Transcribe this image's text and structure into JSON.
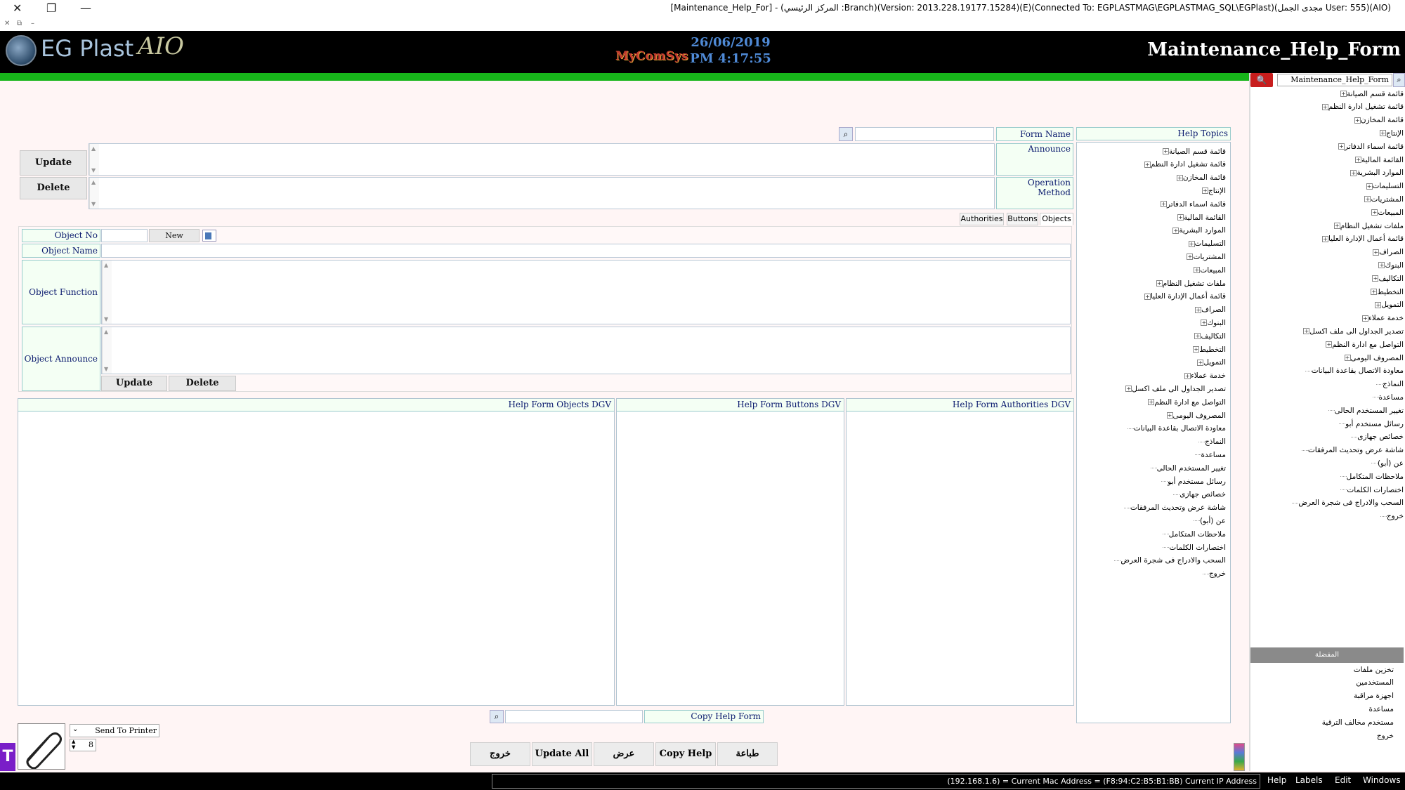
{
  "window": {
    "title": "[Maintenance_Help_For] - (المركز الرئيسي :Branch)(Version: 2013.228.19177.15284)(E)(Connected To: EGPLASTMAG\\EGPLASTMAG_SQL\\EGPlast)(مجدى الجمل User: 555)(AIO)",
    "close_glyph": "✕",
    "restore_glyph": "❐",
    "min_glyph": "—",
    "mini_close": "✕",
    "mini_restore": "⧉",
    "mini_min": "–"
  },
  "header": {
    "logo_text": "EG Plast",
    "logo_suffix": "AIO",
    "brand": "MyComSys",
    "date": "26/06/2019",
    "time": "PM 4:17:55",
    "form_title": "Maintenance_Help_Form"
  },
  "side_panel": {
    "search_value": "Maintenance_Help_Form",
    "search_button": "🔍",
    "items": [
      {
        "label": "قائمة قسم الصيانة",
        "expandable": true
      },
      {
        "label": "قائمة تشغيل ادارة النظم",
        "expandable": true
      },
      {
        "label": "قائمة المخازن",
        "expandable": true
      },
      {
        "label": "الإنتاج",
        "expandable": true
      },
      {
        "label": "قائمة اسماء الدفاتر",
        "expandable": true
      },
      {
        "label": "القائمة المالية",
        "expandable": true
      },
      {
        "label": "الموارد البشرية",
        "expandable": true
      },
      {
        "label": "التسليمات",
        "expandable": true
      },
      {
        "label": "المشتريات",
        "expandable": true
      },
      {
        "label": "المبيعات",
        "expandable": true
      },
      {
        "label": "ملفات تشغيل النظام",
        "expandable": true
      },
      {
        "label": "قائمة أعمال الإدارة العليا",
        "expandable": true
      },
      {
        "label": "الصراف",
        "expandable": true
      },
      {
        "label": "البنوك",
        "expandable": true
      },
      {
        "label": "التكاليف",
        "expandable": true
      },
      {
        "label": "التخطيط",
        "expandable": true
      },
      {
        "label": "التمويل",
        "expandable": true
      },
      {
        "label": "خدمة عملاء",
        "expandable": true
      },
      {
        "label": "تصدير الجداول الى ملف اكسل",
        "expandable": true
      },
      {
        "label": "التواصل مع ادارة النظم",
        "expandable": true
      },
      {
        "label": "المصروف اليومى",
        "expandable": true
      },
      {
        "label": "معاودة الاتصال بقاعدة البيانات",
        "expandable": false
      },
      {
        "label": "النماذج",
        "expandable": false
      },
      {
        "label": "مساعدة",
        "expandable": false
      },
      {
        "label": "تغيير المستخدم الحالى",
        "expandable": false
      },
      {
        "label": "رسائل مستخدم أبو",
        "expandable": false
      },
      {
        "label": "خصائص جهازى",
        "expandable": false
      },
      {
        "label": "شاشة عرض وتحديث المرفقات",
        "expandable": false
      },
      {
        "label": "عن (أبو)",
        "expandable": false
      },
      {
        "label": "ملاحظات المتكامل",
        "expandable": false
      },
      {
        "label": "اختصارات الكلمات",
        "expandable": false
      },
      {
        "label": "السحب والادراج فى شجرة العرض",
        "expandable": false
      },
      {
        "label": "خروج",
        "expandable": false
      }
    ],
    "favorites_title": "المفضلة",
    "favorites": [
      {
        "label": "تخزين ملفات"
      },
      {
        "label": "المستخدمين"
      },
      {
        "label": "اجهزة مراقبة"
      },
      {
        "label": "مساعدة"
      },
      {
        "label": "مستخدم مخالف الترقية"
      },
      {
        "label": "خروج"
      }
    ]
  },
  "form": {
    "help_topics_label": "Help Topics",
    "form_name_label": "Form Name",
    "form_name_value": "",
    "announce_label": "Announce",
    "operation_method_label": "Operation Method",
    "update_label": "Update",
    "delete_label": "Delete",
    "tabs": [
      {
        "label": "Authorities"
      },
      {
        "label": "Buttons"
      },
      {
        "label": "Objects"
      }
    ],
    "object_no_label": "Object No",
    "object_no_value": "",
    "new_label": "New",
    "object_name_label": "Object Name",
    "object_function_label": "Object Function",
    "object_announce_label": "Object Announce",
    "obj_update_label": "Update",
    "obj_delete_label": "Delete",
    "dgv_objects": "Help Form Objects DGV",
    "dgv_buttons": "Help Form Buttons DGV",
    "dgv_authorities": "Help Form Authorities DGV",
    "copy_help_form_label": "Copy Help Form",
    "copy_search_value": ""
  },
  "bottom": {
    "send_to_printer": "Send To Printer",
    "copies": "8",
    "buttons": [
      {
        "label": "خروج"
      },
      {
        "label": "Update All"
      },
      {
        "label": "عرض"
      },
      {
        "label": "Copy Help"
      },
      {
        "label": "طباعة"
      }
    ]
  },
  "status": {
    "ip_info": "(192.168.1.6) = Current Mac Address = (F8:94:C2:B5:B1:BB) Current IP Address",
    "menu": [
      {
        "label": "Help"
      },
      {
        "label": "Labels"
      },
      {
        "label": "Edit"
      },
      {
        "label": "Windows"
      }
    ]
  },
  "colors": {
    "header_bg": "#000000",
    "green_bar": "#17b51a",
    "label_text": "#0a1a6e",
    "label_bg": "#f4fff4",
    "page_bg": "#fff5f5",
    "date_color": "#4f8ad6",
    "search_red": "#c81d1d"
  }
}
